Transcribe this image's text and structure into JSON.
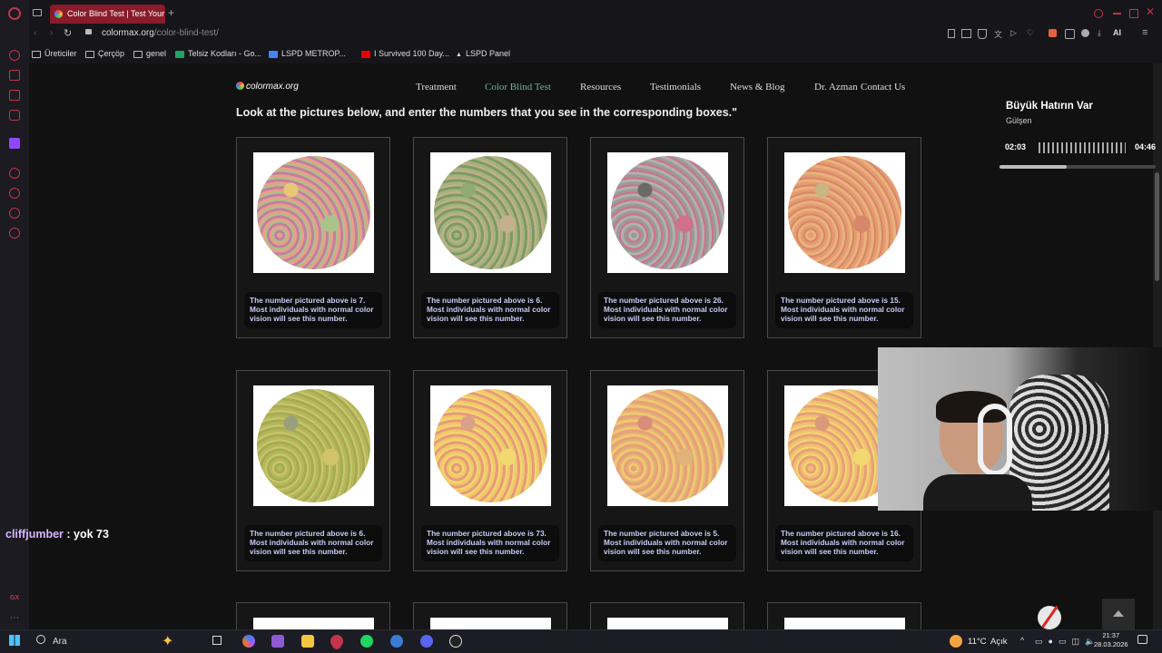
{
  "browser": {
    "tab_title": "Color Blind Test | Test Your",
    "url_domain": "colormax.org",
    "url_path": "/color-blind-test/",
    "ai_label": "AI"
  },
  "bookmarks": [
    "Üreticiler",
    "Çerçöp",
    "genel",
    "Telsiz Kodları - Go...",
    "LSPD METROP...",
    "I Survived 100 Day...",
    "LSPD Panel"
  ],
  "site": {
    "logo": "colormax.org",
    "nav": [
      "Treatment",
      "Color Blind Test",
      "Resources",
      "Testimonials",
      "News & Blog",
      "Dr. Azman",
      "Contact Us"
    ],
    "active_nav": "Color Blind Test",
    "instruction": "Look at the pictures below, and enter the numbers that you see in the corresponding boxes.\""
  },
  "plates": [
    {
      "caption": "The number pictured above is 7. Most individuals with normal color vision will see this number.",
      "colors": [
        "#e8a089",
        "#c47fa0",
        "#a8c48a",
        "#e8c776"
      ]
    },
    {
      "caption": "The number pictured above is 6. Most individuals with normal color vision will see this number.",
      "colors": [
        "#a6b27a",
        "#7d9a67",
        "#c3b08c",
        "#8faa73"
      ]
    },
    {
      "caption": "The number pictured above is 26. Most individuals with normal color vision will see this number.",
      "colors": [
        "#9a9a9a",
        "#b0b0b0",
        "#d0708a",
        "#6a6a6a"
      ]
    },
    {
      "caption": "The number pictured above is 15. Most individuals with normal color vision will see this number.",
      "colors": [
        "#e89a72",
        "#e8b37a",
        "#d6876a",
        "#c9b482"
      ]
    },
    {
      "caption": "The number pictured above is 6. Most individuals with normal color vision will see this number.",
      "colors": [
        "#b5b85a",
        "#a3ac55",
        "#d0c36a",
        "#9aa07c"
      ]
    },
    {
      "caption": "The number pictured above is 73. Most individuals with normal color vision will see this number.",
      "colors": [
        "#f0c96a",
        "#e89a7a",
        "#f2d870",
        "#d9a08a"
      ]
    },
    {
      "caption": "The number pictured above is 5. Most individuals with normal color vision will see this number.",
      "colors": [
        "#e8a078",
        "#f0c870",
        "#e0b37a",
        "#d98c7a"
      ]
    },
    {
      "caption": "The number pictured above is 16. Most individuals with normal color vision will see this number.",
      "colors": [
        "#f0c070",
        "#e8a078",
        "#f2d870",
        "#d99a7a"
      ]
    }
  ],
  "music": {
    "song": "Büyük Hatırın Var",
    "artist": "Gülşen",
    "elapsed": "02:03",
    "total": "04:46",
    "progress": 0.43
  },
  "chat": {
    "user": "cliffjumber",
    "message": " : yok 73"
  },
  "taskbar": {
    "search_placeholder": "Ara",
    "weather": "11°C",
    "weather_text": "Açık",
    "time": "21:37",
    "date": "28.03.2026"
  }
}
